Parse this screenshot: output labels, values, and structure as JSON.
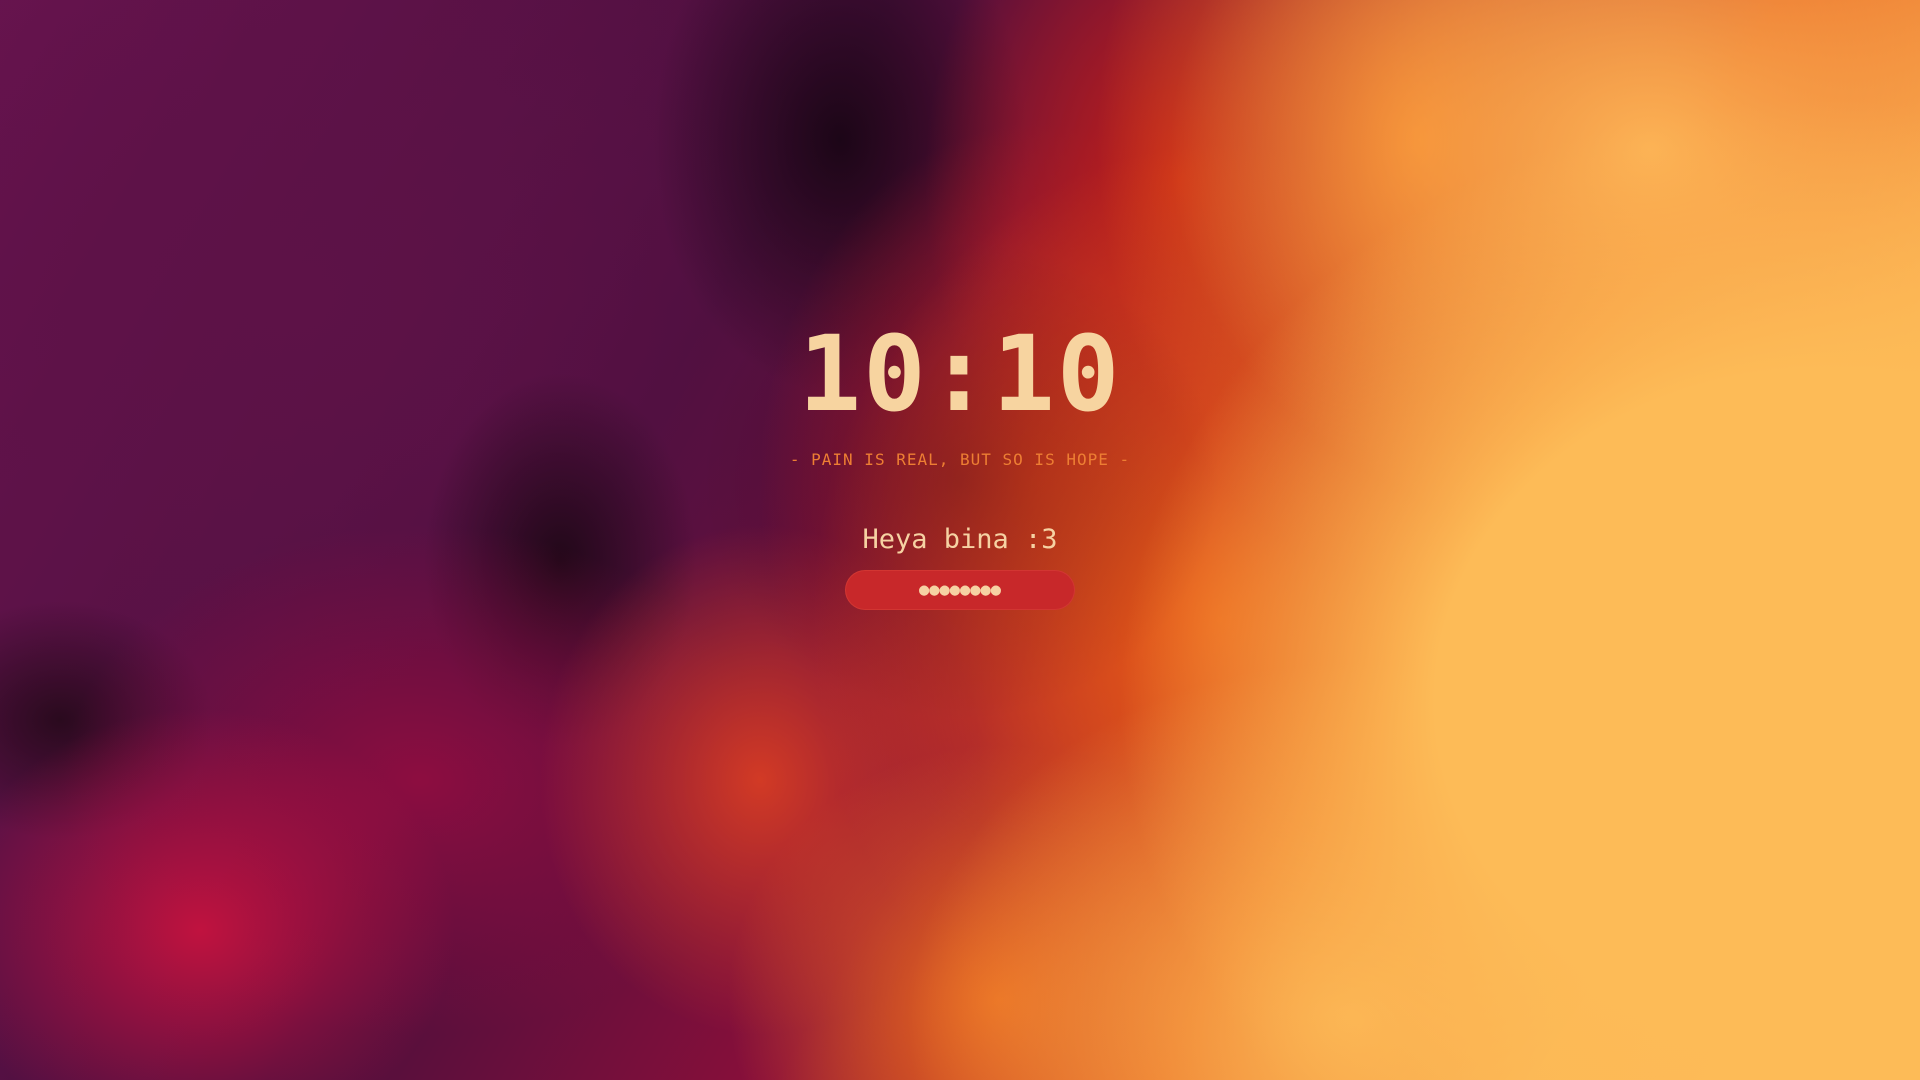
{
  "lockscreen": {
    "time": "10:10",
    "quote": "- PAIN IS REAL, BUT SO IS HOPE -",
    "greeting": "Heya bina :3",
    "password_mask": "●●●●●●●●"
  },
  "colors": {
    "clock_text": "#f7d4a0",
    "quote_text": "#ed7e33",
    "greeting_text": "#f6d2a3",
    "input_background": "#c8282a",
    "wallpaper_dark": "#4a0f3d",
    "wallpaper_mid": "#c11f1f",
    "wallpaper_light": "#fdbb57"
  }
}
